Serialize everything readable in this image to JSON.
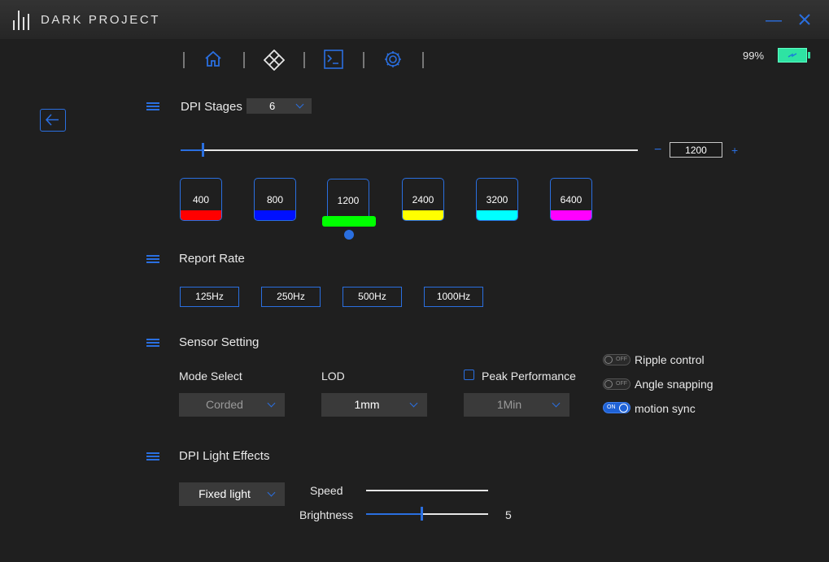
{
  "app": {
    "brand": "DARK PROJECT"
  },
  "battery": {
    "percent": "99%",
    "level": 0.99,
    "color": "#2ee3a3"
  },
  "accent_color": "#2a6fe0",
  "nav": {
    "items": [
      {
        "name": "home",
        "icon": "home-icon"
      },
      {
        "name": "buttons",
        "icon": "diamond-grid-icon"
      },
      {
        "name": "macro",
        "icon": "terminal-icon"
      },
      {
        "name": "settings",
        "icon": "gear-icon"
      }
    ]
  },
  "dpi": {
    "title": "DPI Stages",
    "stages_count": "6",
    "current_value": "1200",
    "slider_level": 0.047,
    "minus_label": "−",
    "plus_label": "+",
    "stages": [
      {
        "value": "400",
        "color": "#ff0000"
      },
      {
        "value": "800",
        "color": "#0010ff"
      },
      {
        "value": "1200",
        "color": "#00ff00",
        "active": true
      },
      {
        "value": "2400",
        "color": "#ffff00"
      },
      {
        "value": "3200",
        "color": "#00ffff"
      },
      {
        "value": "6400",
        "color": "#ff00ff"
      }
    ]
  },
  "report_rate": {
    "title": "Report Rate",
    "options": [
      "125Hz",
      "250Hz",
      "500Hz",
      "1000Hz"
    ]
  },
  "sensor": {
    "title": "Sensor Setting",
    "mode_label": "Mode Select",
    "mode_value": "Corded",
    "lod_label": "LOD",
    "lod_value": "1mm",
    "peak_label": "Peak Performance",
    "peak_checked": false,
    "peak_value": "1Min",
    "toggles": [
      {
        "label": "Ripple control",
        "state": "OFF"
      },
      {
        "label": "Angle snapping",
        "state": "OFF"
      },
      {
        "label": "motion sync",
        "state": "ON"
      }
    ]
  },
  "light": {
    "title": "DPI Light Effects",
    "effect_value": "Fixed light",
    "speed_label": "Speed",
    "brightness_label": "Brightness",
    "brightness_value": "5",
    "brightness_level": 0.45
  }
}
